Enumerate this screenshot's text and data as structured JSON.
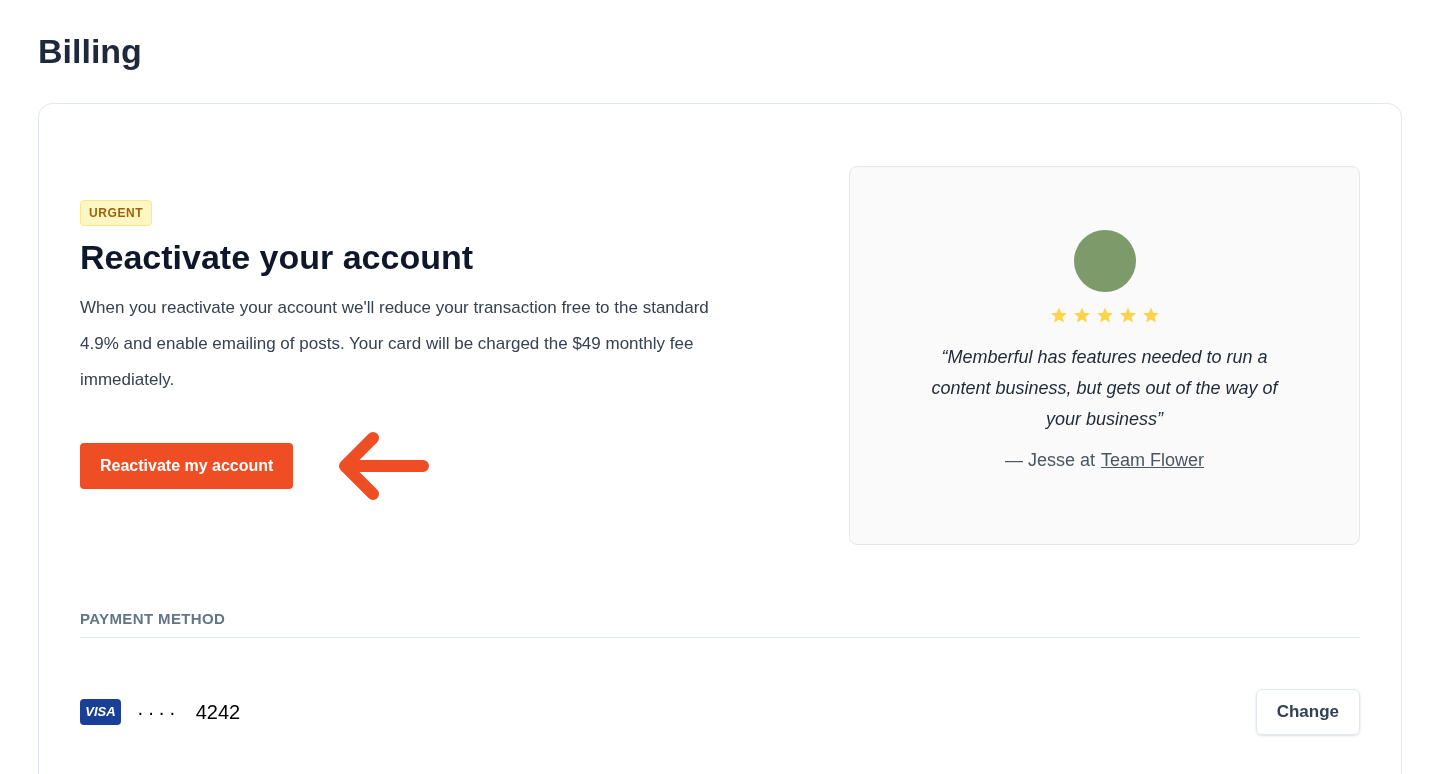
{
  "page_title": "Billing",
  "reactivate": {
    "badge": "URGENT",
    "heading": "Reactivate your account",
    "body": "When you reactivate your account we'll reduce your transaction free to the standard 4.9% and enable emailing of posts. Your card will be charged the $49 monthly fee immediately.",
    "button": "Reactivate my account"
  },
  "testimonial": {
    "stars": 5,
    "quote": "“Memberful has features needed to run a content business, but gets out of the way of your business”",
    "attribution": "— Jesse at",
    "link": "Team Flower"
  },
  "payment_method": {
    "heading": "PAYMENT METHOD",
    "brand": "VISA",
    "mask": "····",
    "last4": "4242",
    "button": "Change"
  }
}
